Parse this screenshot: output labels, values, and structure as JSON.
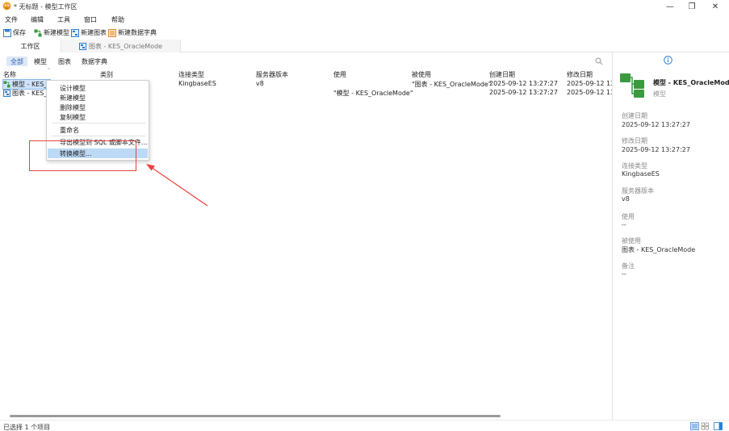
{
  "window": {
    "title": "* 无标题 - 模型工作区",
    "minimize_label": "—",
    "maximize_label": "❐",
    "close_label": "✕"
  },
  "menu": [
    "文件",
    "编辑",
    "工具",
    "窗口",
    "帮助"
  ],
  "toolbar": {
    "save_label": "保存",
    "new_model_label": "新建模型",
    "new_chart_label": "新建图表",
    "new_dict_label": "新建数据字典"
  },
  "tabs": {
    "workspace": "工作区",
    "chart": "图表 - KES_OracleMode"
  },
  "filters": [
    "全部",
    "模型",
    "图表",
    "数据字典"
  ],
  "columns": [
    "名称",
    "类别",
    "连接类型",
    "服务器版本",
    "使用",
    "被使用",
    "创建日期",
    "修改日期"
  ],
  "rows": [
    {
      "name": "模型 - KES_OracleMode",
      "category": "",
      "connection": "KingbaseES",
      "version": "v8",
      "uses": "",
      "used_by": "\"图表 - KES_OracleMode\"",
      "created": "2025-09-12 13:27:27",
      "modified": "2025-09-12 13:27:27"
    },
    {
      "name": "图表 - KES_OracleMode",
      "category": "",
      "connection": "",
      "version": "",
      "uses": "\"模型 - KES_OracleMode\"",
      "used_by": "",
      "created": "2025-09-12 13:27:27",
      "modified": "2025-09-12 13:27:27"
    }
  ],
  "context_menu": {
    "design": "设计模型",
    "new": "新建模型",
    "delete": "删除模型",
    "duplicate": "复制模型",
    "rename": "重命名",
    "export": "导出模型到 SQL 或脚本文件...",
    "convert": "转换模型..."
  },
  "details": {
    "title": "模型 - KES_OracleMode",
    "subtitle": "模型",
    "created_label": "创建日期",
    "created_value": "2025-09-12 13:27:27",
    "modified_label": "修改日期",
    "modified_value": "2025-09-12 13:27:27",
    "conn_label": "连接类型",
    "conn_value": "KingbaseES",
    "version_label": "服务器版本",
    "version_value": "v8",
    "uses_label": "使用",
    "uses_value": "--",
    "used_by_label": "被使用",
    "used_by_value": "图表 - KES_OracleMode",
    "notes_label": "备注",
    "notes_value": "--"
  },
  "status": {
    "selection": "已选择 1 个项目"
  },
  "colors": {
    "accent": "#2a7fd4",
    "model_icon_green": "#3a9a3f",
    "highlight_box": "#e9433f"
  },
  "icons": [
    "app-icon",
    "save-icon",
    "new-model-icon",
    "new-chart-icon",
    "new-dict-icon",
    "search-icon",
    "info-icon",
    "model-icon",
    "chart-icon",
    "list-view-icon",
    "grid-view-icon",
    "panel-view-icon"
  ]
}
